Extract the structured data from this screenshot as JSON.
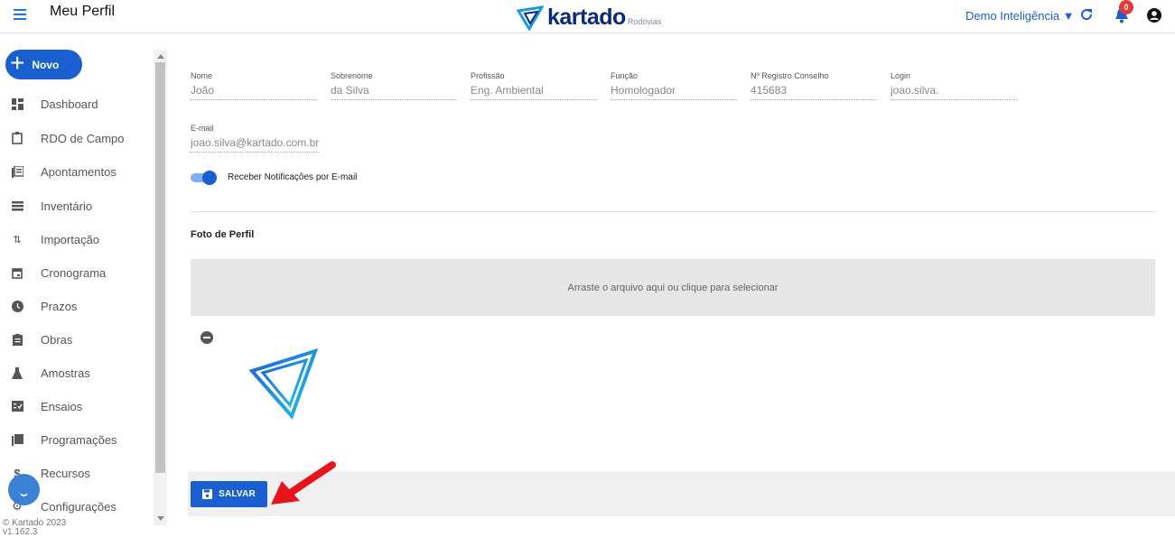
{
  "header": {
    "title": "Meu Perfil",
    "logo_main": "kartado",
    "logo_sub": "Rodovias",
    "org_label": "Demo Inteligência ▼",
    "notification_count": "0"
  },
  "sidebar": {
    "new_button": "Novo",
    "items": [
      {
        "label": "Dashboard",
        "icon": "dashboard-icon"
      },
      {
        "label": "RDO de Campo",
        "icon": "clipboard-icon"
      },
      {
        "label": "Apontamentos",
        "icon": "list-icon"
      },
      {
        "label": "Inventário",
        "icon": "inventory-icon"
      },
      {
        "label": "Importação",
        "icon": "import-icon"
      },
      {
        "label": "Cronograma",
        "icon": "calendar-icon"
      },
      {
        "label": "Prazos",
        "icon": "clock-icon"
      },
      {
        "label": "Obras",
        "icon": "works-icon"
      },
      {
        "label": "Amostras",
        "icon": "flask-icon"
      },
      {
        "label": "Ensaios",
        "icon": "test-icon"
      },
      {
        "label": "Programações",
        "icon": "schedule-icon"
      },
      {
        "label": "Recursos",
        "icon": "dollar-icon"
      },
      {
        "label": "Configurações",
        "icon": "gear-icon"
      }
    ],
    "copyright": "© Kartado 2023",
    "version": "v1.162.3"
  },
  "profile": {
    "fields": [
      {
        "label": "Nome",
        "value": "João"
      },
      {
        "label": "Sobrenome",
        "value": "da Silva"
      },
      {
        "label": "Profissão",
        "value": "Eng. Ambiental"
      },
      {
        "label": "Função",
        "value": "Homologador"
      },
      {
        "label": "Nº Registro Conselho",
        "value": "415683"
      },
      {
        "label": "Login",
        "value": "joao.silva."
      }
    ],
    "email_label": "E-mail",
    "email_value": "joao.silva@kartado.com.br",
    "notify_label": "Receber Notificações por E-mail",
    "notify_enabled": true
  },
  "photo": {
    "section_title": "Foto de Perfil",
    "dropzone_text": "Arraste o arquivo aqui ou clique para selecionar"
  },
  "actions": {
    "save_label": "SALVAR"
  },
  "colors": {
    "primary": "#1a5fd0",
    "badge": "#e53935",
    "annotation_arrow": "#e8141c"
  }
}
